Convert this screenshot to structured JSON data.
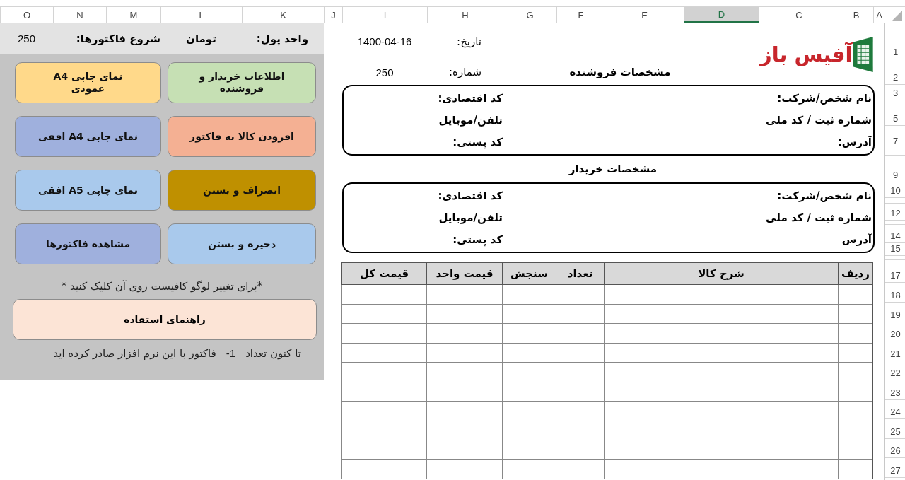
{
  "columns": [
    {
      "label": "A",
      "selected": false
    },
    {
      "label": "B",
      "selected": false
    },
    {
      "label": "C",
      "selected": false
    },
    {
      "label": "D",
      "selected": true
    },
    {
      "label": "E",
      "selected": false
    },
    {
      "label": "F",
      "selected": false
    },
    {
      "label": "G",
      "selected": false
    },
    {
      "label": "H",
      "selected": false
    },
    {
      "label": "I",
      "selected": false
    },
    {
      "label": "J",
      "selected": false
    },
    {
      "label": "K",
      "selected": false
    },
    {
      "label": "L",
      "selected": false
    },
    {
      "label": "M",
      "selected": false
    },
    {
      "label": "N",
      "selected": false
    },
    {
      "label": "O",
      "selected": false
    }
  ],
  "row_numbers": [
    "1",
    "2",
    "3",
    "5",
    "7",
    "9",
    "10",
    "12",
    "14",
    "15",
    "17",
    "18",
    "19",
    "20",
    "21",
    "22",
    "23",
    "24",
    "25",
    "26",
    "27"
  ],
  "settings": {
    "currency_label": "واحد پول:",
    "currency": "تومان",
    "start_label": "شروع فاکتورها:",
    "start_value": "250"
  },
  "buttons": [
    {
      "label": "اطلاعات خریدار و فروشنده",
      "color": "#c6e0b4"
    },
    {
      "label": "نمای چاپی A4 عمودی",
      "color": "#ffd98a"
    },
    {
      "label": "افزودن کالا به فاکتور",
      "color": "#f4b093"
    },
    {
      "label": "نمای چاپی A4 افقی",
      "color": "#9fb0dd"
    },
    {
      "label": "انصراف و بستن",
      "color": "#bf9000"
    },
    {
      "label": "نمای چاپی A5 افقی",
      "color": "#a9c9ec"
    },
    {
      "label": "ذخیره و بستن",
      "color": "#a9c9ec"
    },
    {
      "label": "مشاهده فاکتورها",
      "color": "#9fb0dd"
    }
  ],
  "logo_note": "*برای تغییر لوگو کافیست روی آن کلیک کنید *",
  "help_button": "راهنمای استفاده",
  "counter": {
    "prefix": "تا کنون تعداد",
    "count": "-1",
    "suffix": "فاکتور با این نرم افزار صادر کرده اید"
  },
  "invoice": {
    "logo": "آفیس باز",
    "date_label": "تاریخ:",
    "date": "1400-04-16",
    "number_label": "شماره:",
    "number": "250",
    "seller": {
      "title": "مشخصات فروشنده",
      "fields": [
        "نام شخص/شرکت:",
        "کد اقتصادی:",
        "شماره ثبت / کد ملی",
        "تلفن/موبایل",
        "آدرس:",
        "کد پستی:"
      ]
    },
    "buyer": {
      "title": "مشخصات خریدار",
      "fields": [
        "نام شخص/شرکت:",
        "کد اقتصادی:",
        "شماره ثبت / کد ملی",
        "تلفن/موبایل",
        "آدرس",
        "کد پستی:"
      ]
    },
    "table": {
      "columns": [
        "ردیف",
        "شرح کالا",
        "تعداد",
        "سنجش",
        "قیمت واحد",
        "قیمت کل"
      ]
    }
  }
}
